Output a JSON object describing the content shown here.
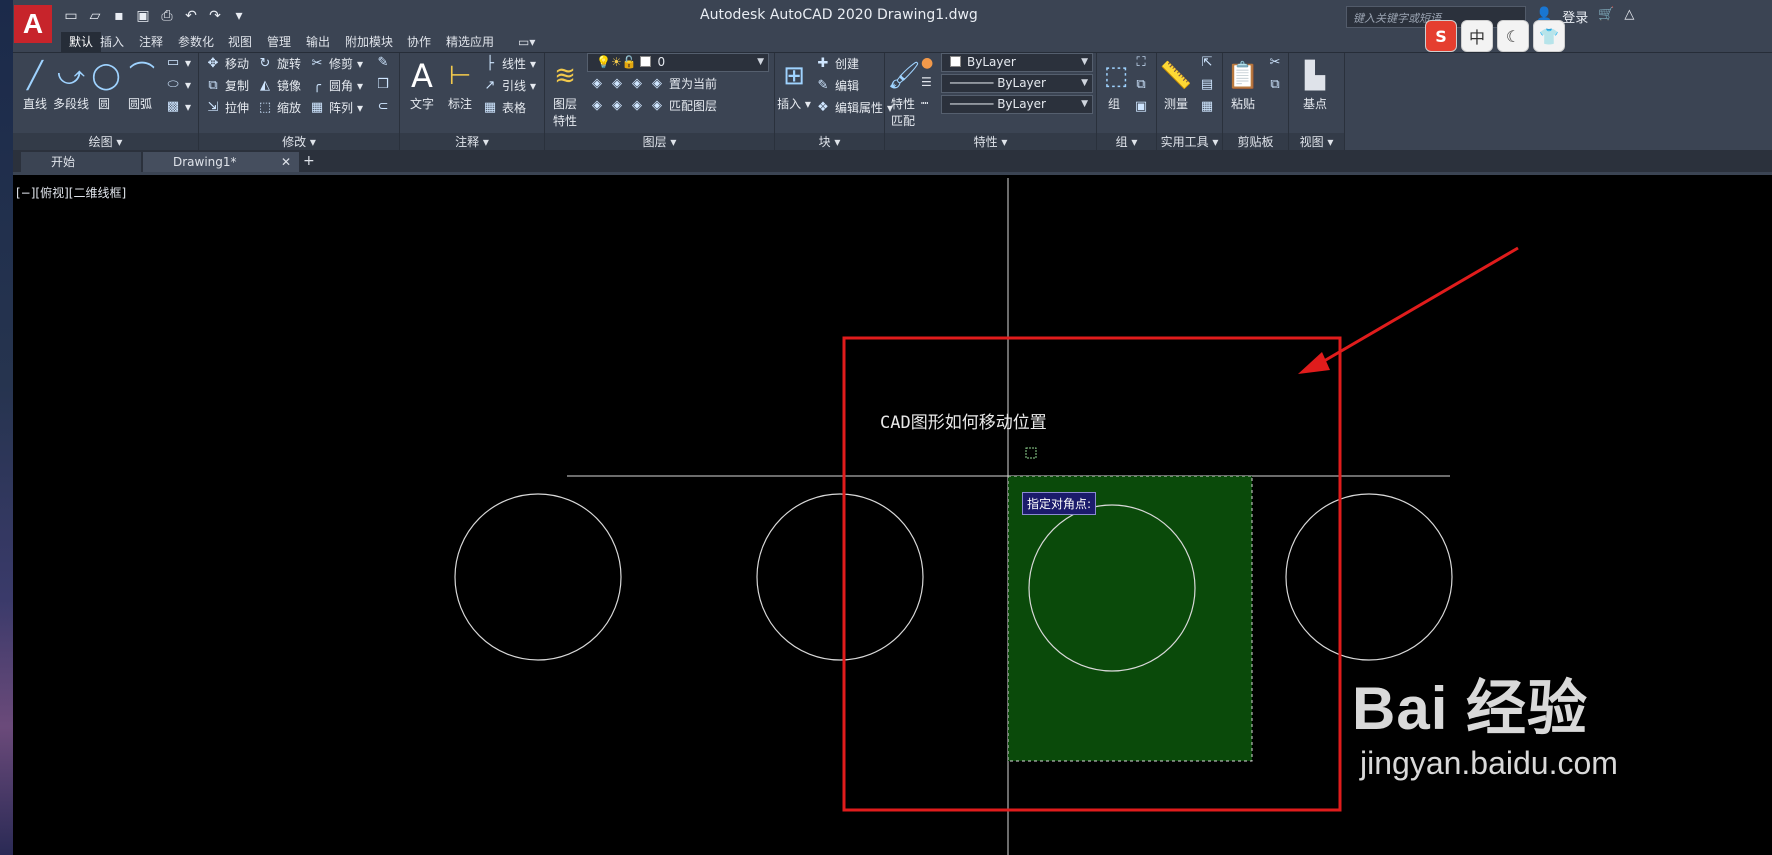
{
  "app": {
    "logo": "A",
    "title": "Autodesk AutoCAD 2020    Drawing1.dwg",
    "search_placeholder": "键入关键字或短语",
    "login": "登录"
  },
  "ime": {
    "s": "S",
    "cn": "中",
    "moon": "☾",
    "shirt": "👕"
  },
  "ribbon_tabs": [
    "默认",
    "插入",
    "注释",
    "参数化",
    "视图",
    "管理",
    "输出",
    "附加模块",
    "协作",
    "精选应用"
  ],
  "panels": {
    "draw": {
      "title": "绘图 ▾",
      "line": "直线",
      "polyline": "多段线",
      "circle": "圆",
      "arc": "圆弧"
    },
    "modify": {
      "title": "修改 ▾",
      "move": "移动",
      "rotate": "旋转",
      "trim": "修剪",
      "copy": "复制",
      "mirror": "镜像",
      "fillet": "圆角",
      "stretch": "拉伸",
      "scale": "缩放",
      "array": "阵列"
    },
    "annotation": {
      "title": "注释 ▾",
      "text": "文字",
      "dimension": "标注",
      "linear": "线性",
      "leader": "引线",
      "table": "表格"
    },
    "layers": {
      "title": "图层 ▾",
      "layer_props": "图层\n特性",
      "current_layer": "0",
      "set_current": "置为当前",
      "match_layer": "匹配图层"
    },
    "block": {
      "title": "块 ▾",
      "insert": "插入",
      "create": "创建",
      "edit": "编辑",
      "edit_attr": "编辑属性"
    },
    "properties": {
      "title": "特性 ▾",
      "match": "特性\n匹配",
      "color": "ByLayer",
      "linetype": "ByLayer",
      "lineweight": "ByLayer"
    },
    "groups": {
      "title": "组 ▾",
      "group": "组"
    },
    "utilities": {
      "title": "实用工具 ▾",
      "measure": "测量"
    },
    "clipboard": {
      "title": "剪贴板",
      "paste": "粘贴"
    },
    "view": {
      "title": "视图 ▾",
      "base": "基点"
    }
  },
  "file_tabs": {
    "start": "开始",
    "drawing": "Drawing1*"
  },
  "viewport": {
    "label": "[−][俯视][二维线框]"
  },
  "drawing": {
    "text": "CAD图形如何移动位置",
    "prompt": "指定对角点:",
    "circles": 4,
    "highlight_color": "#c81414",
    "selection_fill": "#0a4a0a"
  },
  "watermark": {
    "main": "Bai 经验",
    "sub": "jingyan.baidu.com"
  }
}
